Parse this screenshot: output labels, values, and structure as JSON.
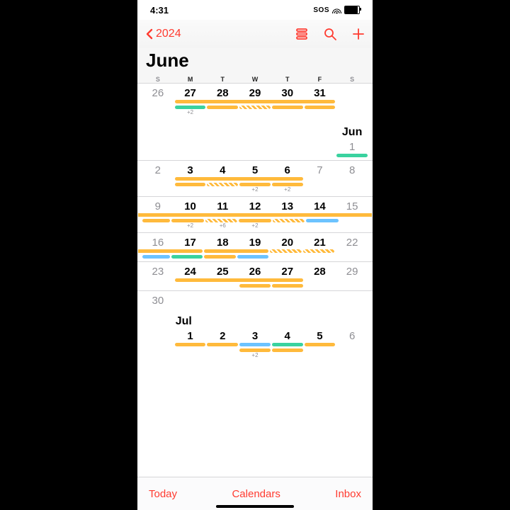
{
  "status": {
    "time": "4:31",
    "sos": "SOS"
  },
  "nav": {
    "back_year": "2024"
  },
  "title": "June",
  "dows": [
    "S",
    "M",
    "T",
    "W",
    "T",
    "F",
    "S"
  ],
  "month_labels": {
    "jun": "Jun",
    "jul": "Jul"
  },
  "weeks": {
    "w0": {
      "d": [
        "26",
        "27",
        "28",
        "29",
        "30",
        "31",
        ""
      ],
      "more": [
        "",
        "+2",
        "",
        "",
        "",
        "",
        ""
      ]
    },
    "w1": {
      "d": [
        "",
        "",
        "",
        "",
        "",
        "",
        "1"
      ]
    },
    "w2": {
      "d": [
        "2",
        "3",
        "4",
        "5",
        "6",
        "7",
        "8"
      ],
      "more": [
        "",
        "",
        "",
        "+2",
        "+2",
        "",
        ""
      ]
    },
    "w3": {
      "d": [
        "9",
        "10",
        "11",
        "12",
        "13",
        "14",
        "15"
      ],
      "more": [
        "",
        "+2",
        "+6",
        "+2",
        "",
        "",
        ""
      ]
    },
    "w4": {
      "d": [
        "16",
        "17",
        "18",
        "19",
        "20",
        "21",
        "22"
      ]
    },
    "w5": {
      "d": [
        "23",
        "24",
        "25",
        "26",
        "27",
        "28",
        "29"
      ]
    },
    "w6": {
      "d": [
        "30",
        "",
        "",
        "",
        "",
        "",
        ""
      ]
    },
    "w7": {
      "d": [
        "",
        "1",
        "2",
        "3",
        "4",
        "5",
        "6"
      ],
      "more": [
        "",
        "",
        "",
        "+2",
        "",
        "",
        ""
      ]
    }
  },
  "bottom": {
    "today": "Today",
    "calendars": "Calendars",
    "inbox": "Inbox"
  }
}
